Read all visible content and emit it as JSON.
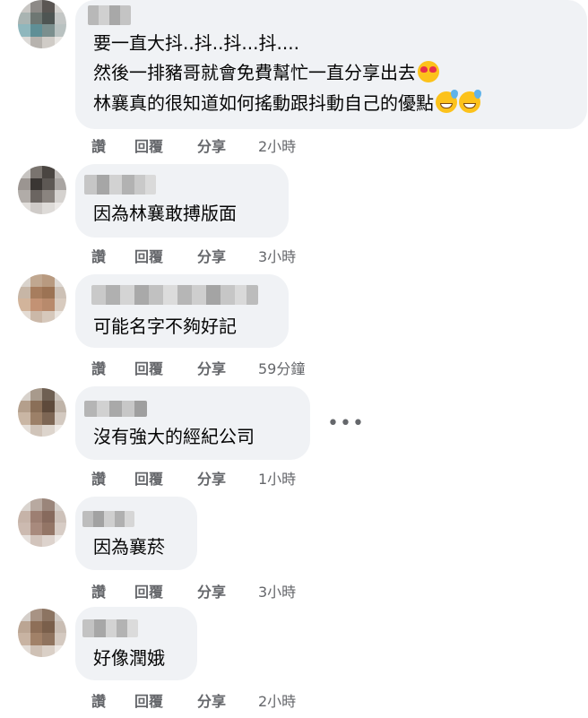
{
  "actions": {
    "like": "讚",
    "reply": "回覆",
    "share": "分享"
  },
  "comments": [
    {
      "lines": [
        "要一直大抖..抖..抖...抖....",
        "然後一排豬哥就會免費幫忙一直分享出去",
        "林襄真的很知道如何搖動跟抖動自己的優點"
      ],
      "emojis": [
        "smiling-face-with-heart-eyes",
        "grinning-face-with-sweat",
        "grinning-face-with-sweat"
      ],
      "time": "2小時"
    },
    {
      "lines": [
        "因為林襄敢搏版面"
      ],
      "time": "3小時"
    },
    {
      "lines": [
        "可能名字不夠好記"
      ],
      "time": "59分鐘"
    },
    {
      "lines": [
        "沒有強大的經紀公司"
      ],
      "time": "1小時"
    },
    {
      "lines": [
        "因為襄菸"
      ],
      "time": "3小時"
    },
    {
      "lines": [
        "好像潤娥"
      ],
      "time": "2小時"
    }
  ],
  "more_options_glyph": "•••",
  "colors": {
    "bubble_bg": "#f0f2f5",
    "action_text": "#65676b",
    "body_text": "#050505"
  }
}
